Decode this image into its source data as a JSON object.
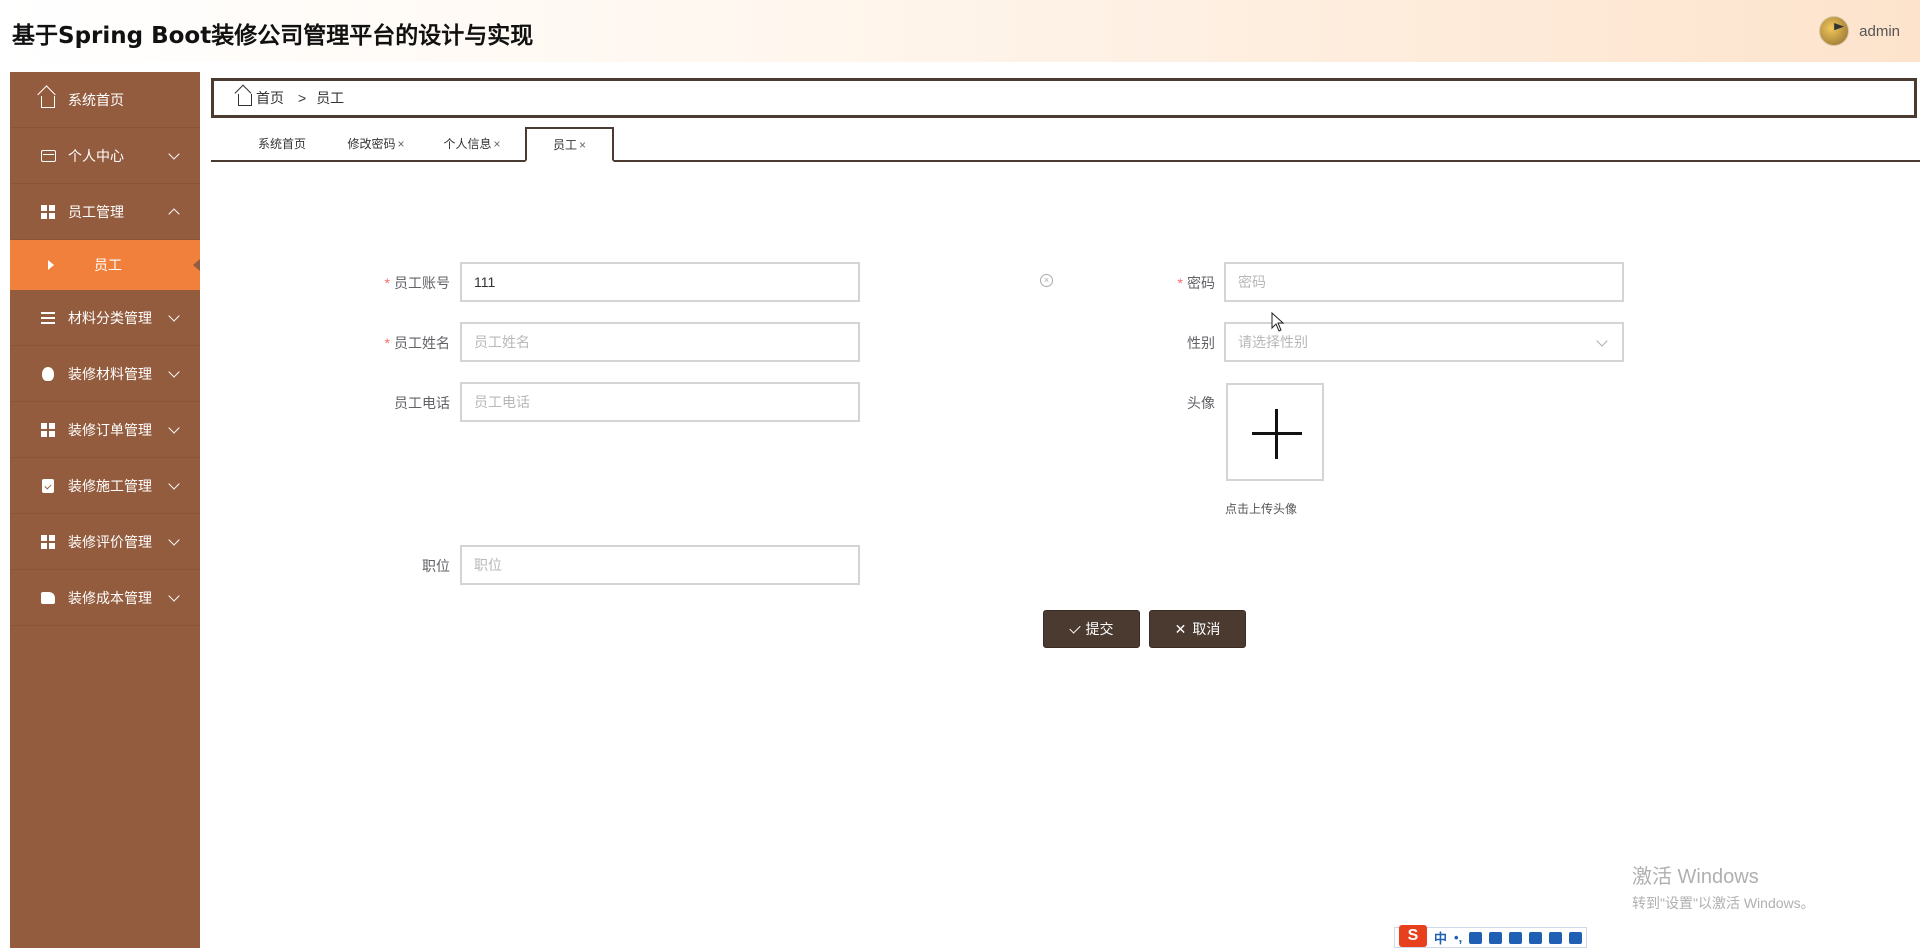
{
  "header": {
    "title": "基于Spring Boot装修公司管理平台的设计与实现",
    "user_name": "admin"
  },
  "sidebar": {
    "items": [
      {
        "label": "系统首页",
        "icon": "home-icon"
      },
      {
        "label": "个人中心",
        "icon": "card-icon"
      },
      {
        "label": "员工管理",
        "icon": "grid-icon",
        "expanded": true
      },
      {
        "label": "材料分类管理",
        "icon": "list-icon"
      },
      {
        "label": "装修材料管理",
        "icon": "bulb-icon"
      },
      {
        "label": "装修订单管理",
        "icon": "grid-icon"
      },
      {
        "label": "装修施工管理",
        "icon": "clipboard-icon"
      },
      {
        "label": "装修评价管理",
        "icon": "grid-icon"
      },
      {
        "label": "装修成本管理",
        "icon": "hand-icon"
      }
    ],
    "active_sub_item": "员工"
  },
  "breadcrumb": {
    "home": "首页",
    "separator": ">",
    "current": "员工"
  },
  "tabs": [
    {
      "label": "系统首页",
      "closable": false
    },
    {
      "label": "修改密码",
      "closable": true
    },
    {
      "label": "个人信息",
      "closable": true
    },
    {
      "label": "员工",
      "closable": true,
      "active": true
    }
  ],
  "tab_close": "×",
  "form": {
    "account": {
      "label": "员工账号",
      "value": "111",
      "required": true
    },
    "password": {
      "label": "密码",
      "placeholder": "密码",
      "required": true
    },
    "name": {
      "label": "员工姓名",
      "placeholder": "员工姓名",
      "required": true
    },
    "gender": {
      "label": "性别",
      "placeholder": "请选择性别"
    },
    "phone": {
      "label": "员工电话",
      "placeholder": "员工电话"
    },
    "avatar": {
      "label": "头像",
      "hint": "点击上传头像"
    },
    "position": {
      "label": "职位",
      "placeholder": "职位"
    },
    "required_mark": "*",
    "submit_label": "提交",
    "cancel_label": "取消"
  },
  "watermark": {
    "title": "激活 Windows",
    "subtitle": "转到\"设置\"以激活 Windows。"
  },
  "ime": {
    "logo": "S",
    "mode": "中",
    "punct": "•,"
  },
  "colors": {
    "sidebar_bg": "#945c3e",
    "sidebar_active": "#f0803c",
    "button_bg": "#4a3a30",
    "required": "#f56c6c"
  }
}
